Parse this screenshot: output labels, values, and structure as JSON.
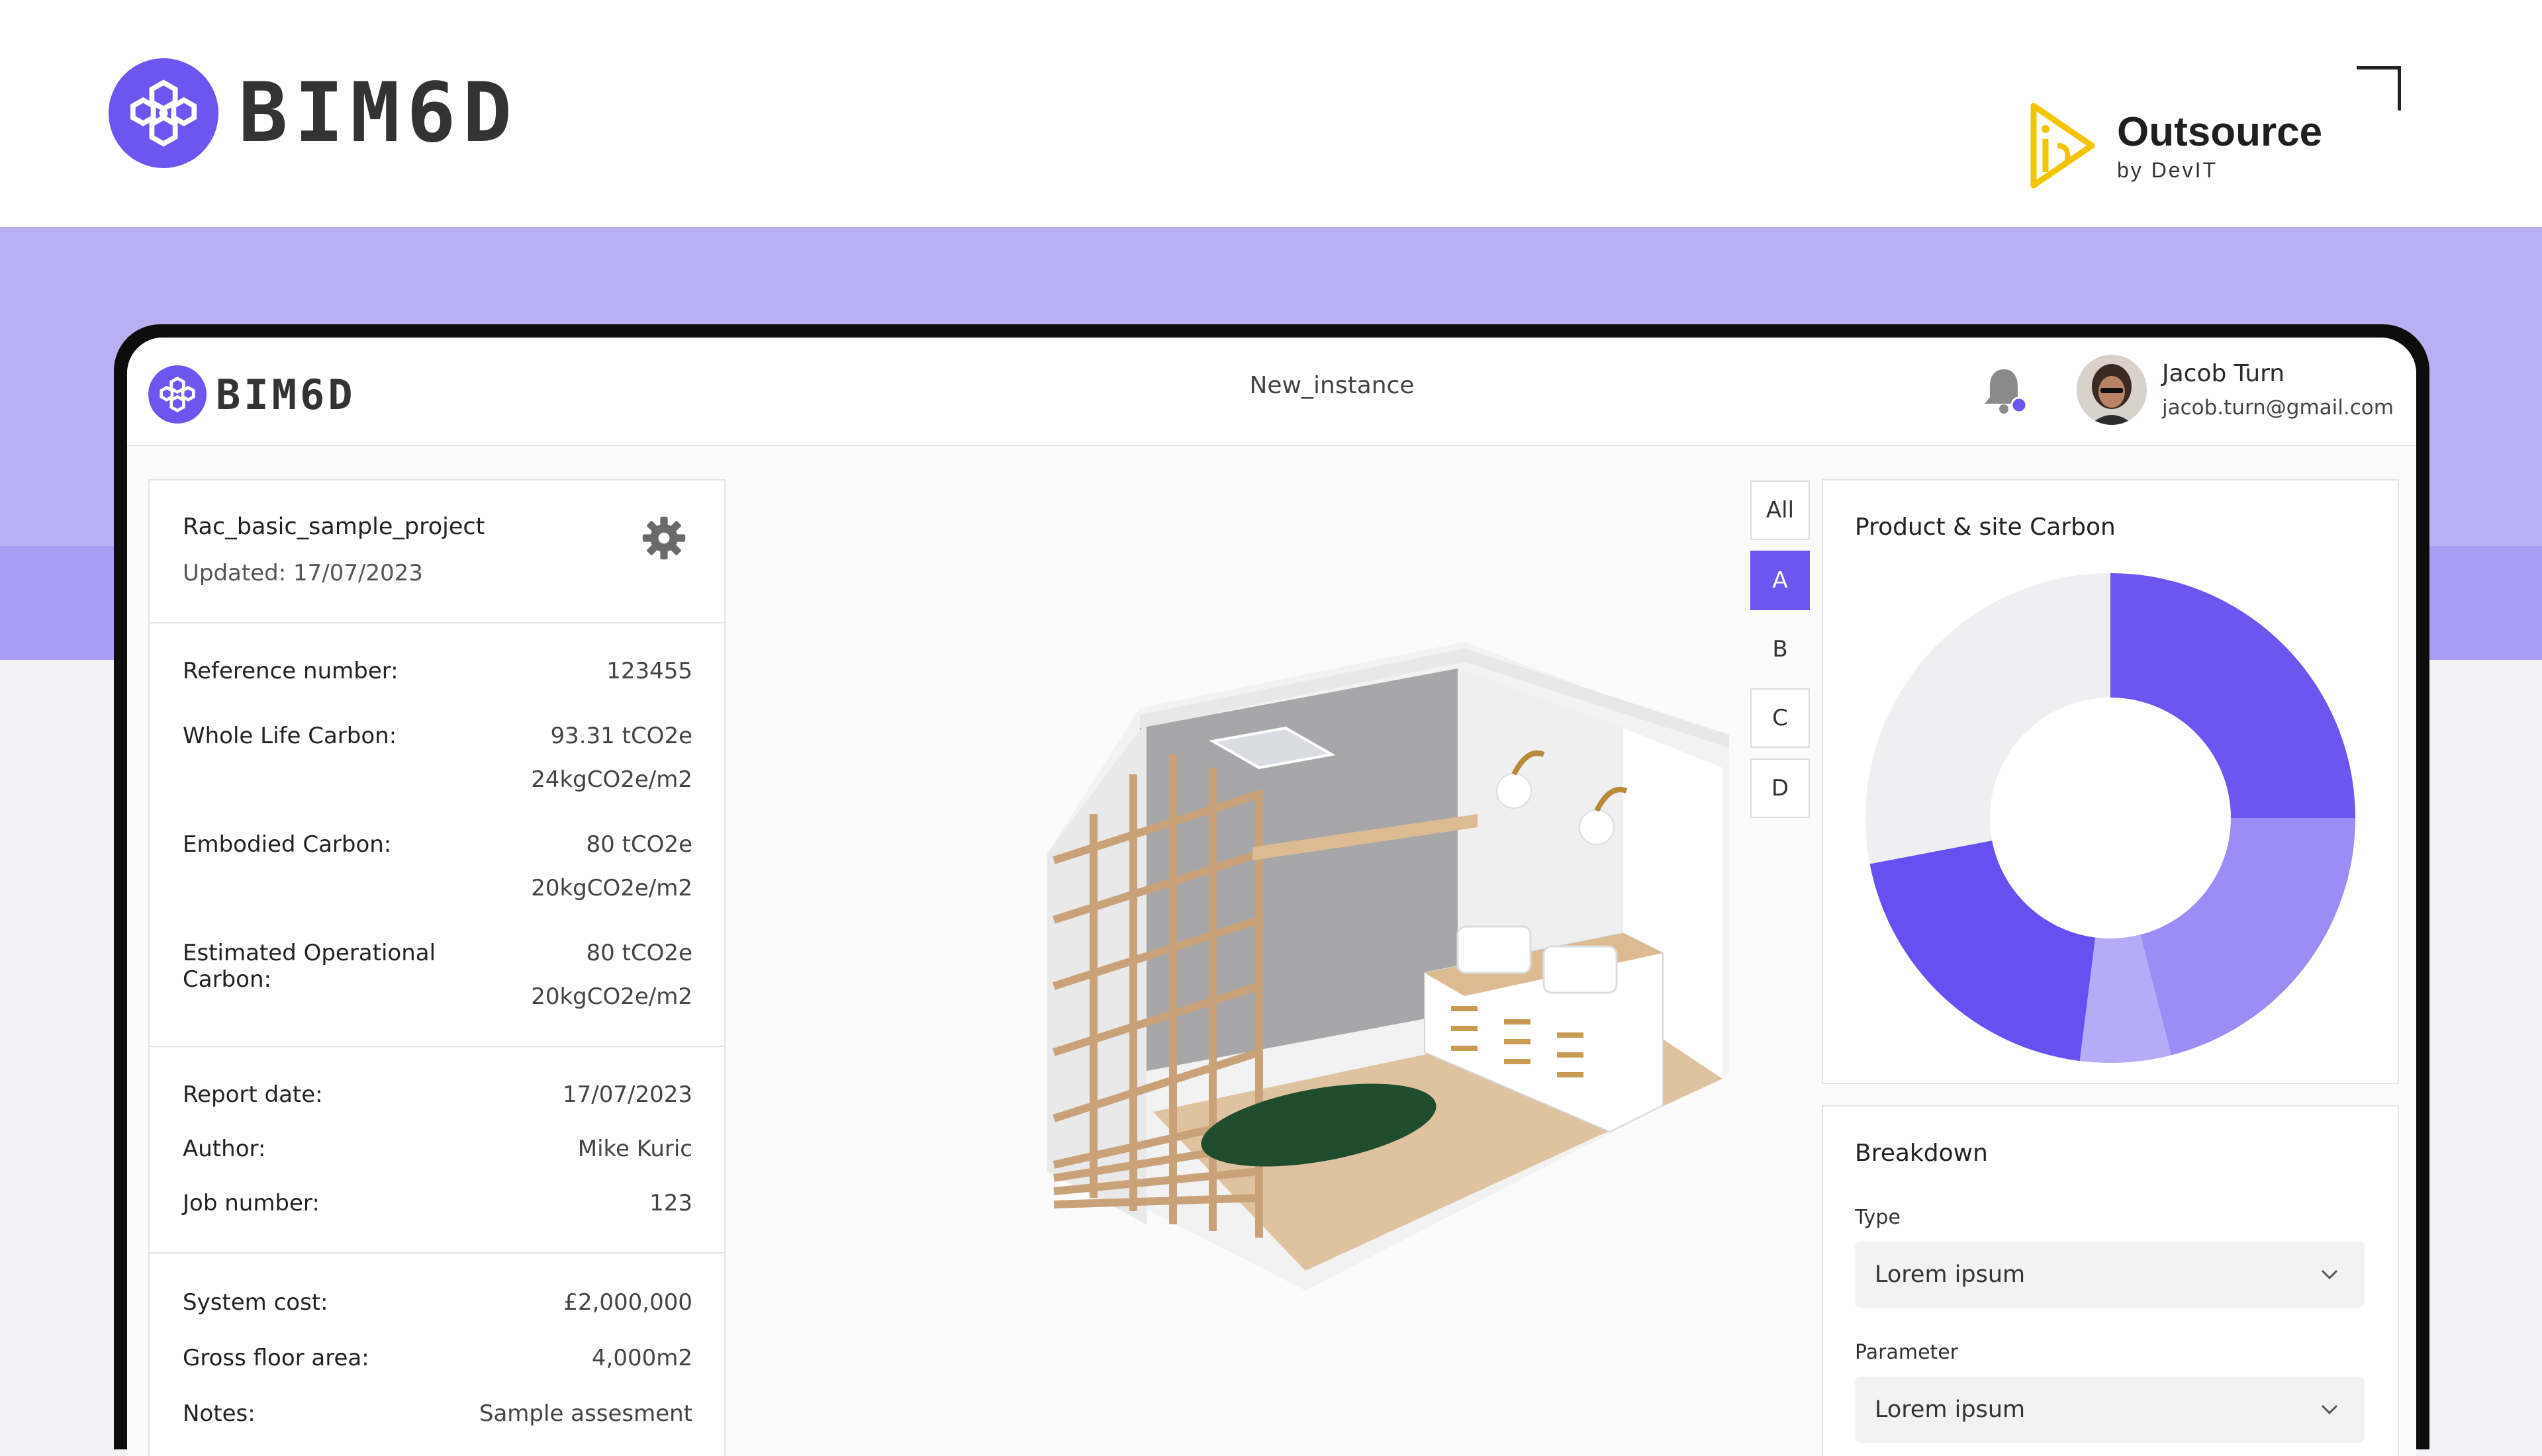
{
  "brand": {
    "name": "BIM6D",
    "logo_icon": "hexagon-cluster-icon",
    "accent": "#6d55f0"
  },
  "partner": {
    "name": "Outsource",
    "byline": "by DevIT",
    "icon": "play-arrow-logo-icon",
    "color": "#f5c400"
  },
  "app": {
    "instance_title": "New_instance",
    "notifications_icon": "bell-icon",
    "user": {
      "name": "Jacob Turn",
      "email": "jacob.turn@gmail.com"
    }
  },
  "project": {
    "title": "Rac_basic_sample_project",
    "updated": "Updated: 17/07/2023",
    "settings_icon": "gear-icon",
    "carbon_rows": [
      {
        "label": "Reference number:",
        "value": "123455"
      },
      {
        "label": "Whole Life Carbon:",
        "value": "93.31 tCO2e",
        "value2": "24kgCO2e/m2"
      },
      {
        "label": "Embodied Carbon:",
        "value": "80 tCO2e",
        "value2": "20kgCO2e/m2"
      },
      {
        "label": "Estimated Operational",
        "label2": "Carbon:",
        "value": "80 tCO2e",
        "value2": "20kgCO2e/m2"
      }
    ],
    "report_rows": [
      {
        "label": "Report date:",
        "value": "17/07/2023"
      },
      {
        "label": "Author:",
        "value": "Mike Kuric"
      },
      {
        "label": "Job number:",
        "value": "123"
      }
    ],
    "cost_rows": [
      {
        "label": "System cost:",
        "value": "£2,000,000"
      },
      {
        "label": "Gross floor area:",
        "value": "4,000m2"
      },
      {
        "label": "Notes:",
        "value": "Sample assesment"
      }
    ]
  },
  "filters": {
    "items": [
      "All",
      "A",
      "B",
      "C",
      "D"
    ],
    "selected": "A"
  },
  "carbon_chart": {
    "title": "Product & site Carbon",
    "type": "donut",
    "segments": [
      {
        "value": 25,
        "color": "#6d55f0"
      },
      {
        "value": 21,
        "color": "#9b8cf6"
      },
      {
        "value": 6,
        "color": "#b6abf6"
      },
      {
        "value": 20,
        "color": "#6650f2"
      },
      {
        "value": 28,
        "color": "#efeff2"
      }
    ]
  },
  "breakdown": {
    "title": "Breakdown",
    "type_label": "Type",
    "type_value": "Lorem ipsum",
    "parameter_label": "Parameter",
    "parameter_value": "Lorem ipsum",
    "chevron_icon": "chevron-down-icon"
  }
}
